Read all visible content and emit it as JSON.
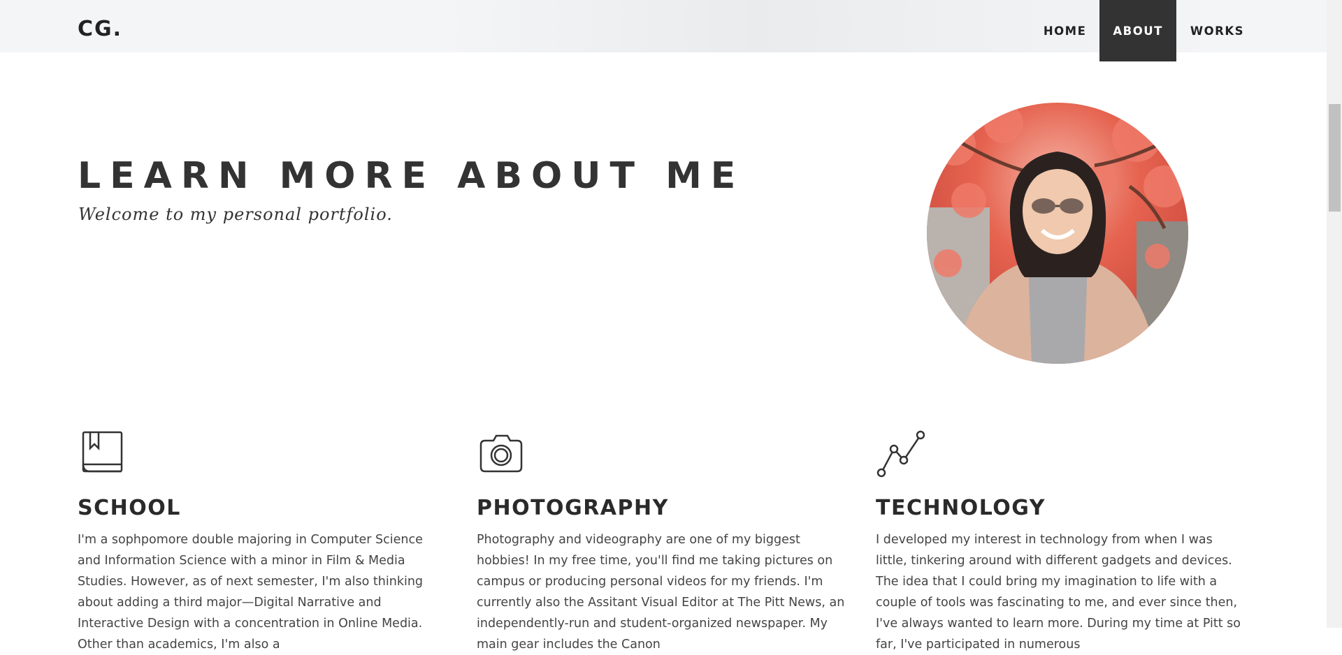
{
  "header": {
    "brand": "CG.",
    "nav": [
      {
        "label": "HOME",
        "active": false
      },
      {
        "label": "ABOUT",
        "active": true
      },
      {
        "label": "WORKS",
        "active": false
      }
    ]
  },
  "hero": {
    "title": "LEARN MORE ABOUT ME",
    "subtitle": "Welcome to my personal portfolio."
  },
  "sections": [
    {
      "icon": "book-icon",
      "heading": "SCHOOL",
      "text": "I'm a sophpomore double majoring in Computer Science and Information Science with a minor in Film & Media Studies. However, as of next semester, I'm also thinking about adding a third major—Digital Narrative and Interactive Design with a concentration in Online Media. Other than academics, I'm also a"
    },
    {
      "icon": "camera-icon",
      "heading": "PHOTOGRAPHY",
      "text": "Photography and videography are one of my biggest hobbies! In my free time, you'll find me taking pictures on campus or producing personal videos for my friends. I'm currently also the Assitant Visual Editor at The Pitt News, an independently-run and student-organized newspaper. My main gear includes the Canon"
    },
    {
      "icon": "line-chart-icon",
      "heading": "TECHNOLOGY",
      "text": "I developed my interest in technology from when I was little, tinkering around with different gadgets and devices. The idea that I could bring my imagination to life with a couple of tools was fascinating to me, and ever since then, I've always wanted to learn more. During my time at Pitt so far, I've participated in numerous"
    }
  ],
  "colors": {
    "nav_active_bg": "#333333",
    "header_bg": "#f4f5f6",
    "text": "#333333"
  }
}
